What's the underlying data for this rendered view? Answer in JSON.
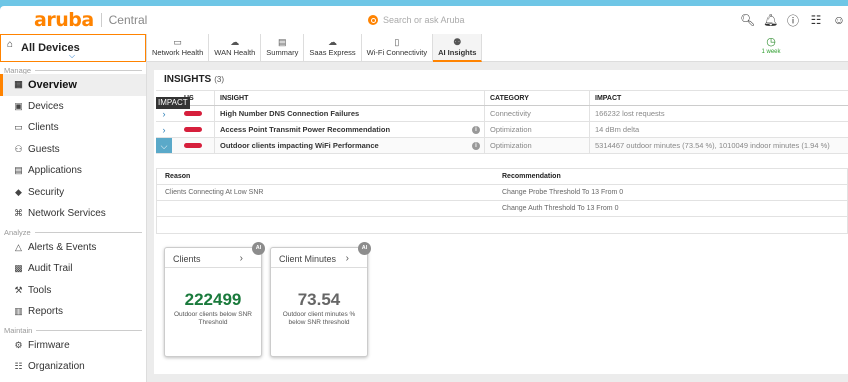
{
  "app": {
    "logo_word": "aruba",
    "logo_sub": "Central",
    "search_placeholder": "Search or ask Aruba",
    "brand_color": "#ff8300"
  },
  "top_icons": [
    "search-icon",
    "bell-icon",
    "help-icon",
    "apps-grid-icon",
    "user-icon"
  ],
  "scope": {
    "label": "All Devices"
  },
  "sidebar": {
    "sections": [
      {
        "label": "Manage",
        "items": [
          {
            "label": "Overview",
            "icon": "overview-icon",
            "active": true
          },
          {
            "label": "Devices",
            "icon": "devices-icon"
          },
          {
            "label": "Clients",
            "icon": "clients-icon"
          },
          {
            "label": "Guests",
            "icon": "guests-icon"
          },
          {
            "label": "Applications",
            "icon": "applications-icon"
          },
          {
            "label": "Security",
            "icon": "security-icon"
          },
          {
            "label": "Network Services",
            "icon": "network-services-icon"
          }
        ]
      },
      {
        "label": "Analyze",
        "items": [
          {
            "label": "Alerts & Events",
            "icon": "bell-icon"
          },
          {
            "label": "Audit Trail",
            "icon": "audit-trail-icon"
          },
          {
            "label": "Tools",
            "icon": "tools-icon"
          },
          {
            "label": "Reports",
            "icon": "reports-icon"
          }
        ]
      },
      {
        "label": "Maintain",
        "items": [
          {
            "label": "Firmware",
            "icon": "firmware-icon"
          },
          {
            "label": "Organization",
            "icon": "organization-icon"
          }
        ]
      }
    ]
  },
  "tabs": [
    {
      "label": "Network Health",
      "icon": "network-health-icon"
    },
    {
      "label": "WAN Health",
      "icon": "wan-health-icon"
    },
    {
      "label": "Summary",
      "icon": "summary-icon"
    },
    {
      "label": "Saas Express",
      "icon": "saas-express-icon"
    },
    {
      "label": "Wi-Fi Connectivity",
      "icon": "wifi-connectivity-icon"
    },
    {
      "label": "AI Insights",
      "icon": "ai-insights-icon",
      "active": true
    }
  ],
  "time_window": {
    "label": "1 week"
  },
  "insights": {
    "title": "INSIGHTS",
    "count": "(3)",
    "tooltip": "IMPACT",
    "columns": {
      "status": "US",
      "insight": "INSIGHT",
      "category": "CATEGORY",
      "impact": "IMPACT"
    },
    "rows": [
      {
        "insight": "High Number DNS Connection Failures",
        "category": "Connectivity",
        "impact": "166232 lost requests",
        "expanded": false,
        "info": false
      },
      {
        "insight": "Access Point Transmit Power Recommendation",
        "category": "Optimization",
        "impact": "14 dBm delta",
        "expanded": false,
        "info": true
      },
      {
        "insight": "Outdoor clients impacting WiFi Performance",
        "category": "Optimization",
        "impact": "5314467 outdoor minutes (73.54 %), 1010049 indoor minutes (1.94 %)",
        "expanded": true,
        "info": true
      }
    ],
    "status_color": "#d61f3c"
  },
  "detail": {
    "columns": {
      "reason": "Reason",
      "recommendation": "Recommendation"
    },
    "rows": [
      {
        "reason": "Clients Connecting At Low SNR",
        "recommendation": "Change Probe Threshold To 13 From 0"
      },
      {
        "reason": "",
        "recommendation": "Change Auth Threshold To 13 From 0"
      }
    ]
  },
  "cards": [
    {
      "title": "Clients",
      "badge": "AI",
      "value": "222499",
      "caption": "Outdoor clients below SNR Threshold",
      "color": "#1a7a3c"
    },
    {
      "title": "Client Minutes",
      "badge": "AI",
      "value": "73.54",
      "caption": "Outdoor client minutes % below SNR threshold",
      "color": "#666666"
    }
  ]
}
